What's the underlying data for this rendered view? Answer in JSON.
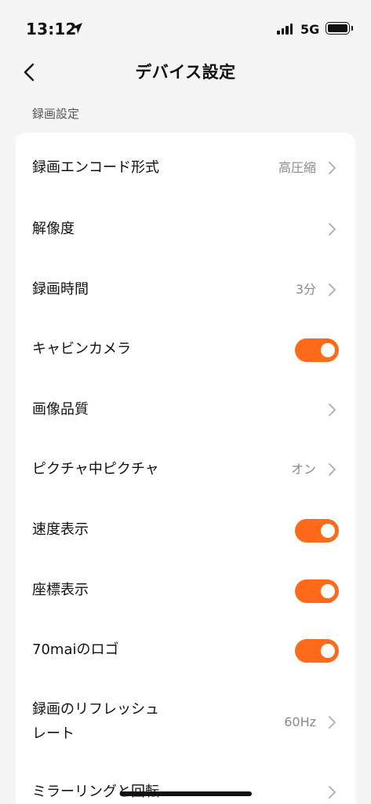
{
  "status_bar": {
    "time": "13:12",
    "network": "5G"
  },
  "header": {
    "title": "デバイス設定"
  },
  "section": {
    "label": "録画設定"
  },
  "rows": [
    {
      "label": "録画エンコード形式",
      "value": "高圧縮",
      "control": "chevron"
    },
    {
      "label": "解像度",
      "value": "",
      "control": "chevron"
    },
    {
      "label": "録画時間",
      "value": "3分",
      "control": "chevron"
    },
    {
      "label": "キャビンカメラ",
      "control": "toggle",
      "on": true
    },
    {
      "label": "画像品質",
      "value": "",
      "control": "chevron"
    },
    {
      "label": "ピクチャ中ピクチャ",
      "value": "オン",
      "control": "chevron"
    },
    {
      "label": "速度表示",
      "control": "toggle",
      "on": true
    },
    {
      "label": "座標表示",
      "control": "toggle",
      "on": true
    },
    {
      "label": "70maiのロゴ",
      "control": "toggle",
      "on": true
    },
    {
      "label_line1": "録画のリフレッシュ",
      "label_line2": "レート",
      "value": "60Hz",
      "control": "chevron"
    },
    {
      "label": "ミラーリングと回転",
      "value": "",
      "control": "chevron"
    }
  ],
  "colors": {
    "accent": "#ff6a1a",
    "background": "#f5f5f5",
    "card": "#ffffff",
    "secondary_text": "#8a8a8a"
  },
  "icons": {
    "back": "chevron-left-icon",
    "row_arrow": "chevron-right-icon",
    "location": "location-arrow-icon"
  }
}
